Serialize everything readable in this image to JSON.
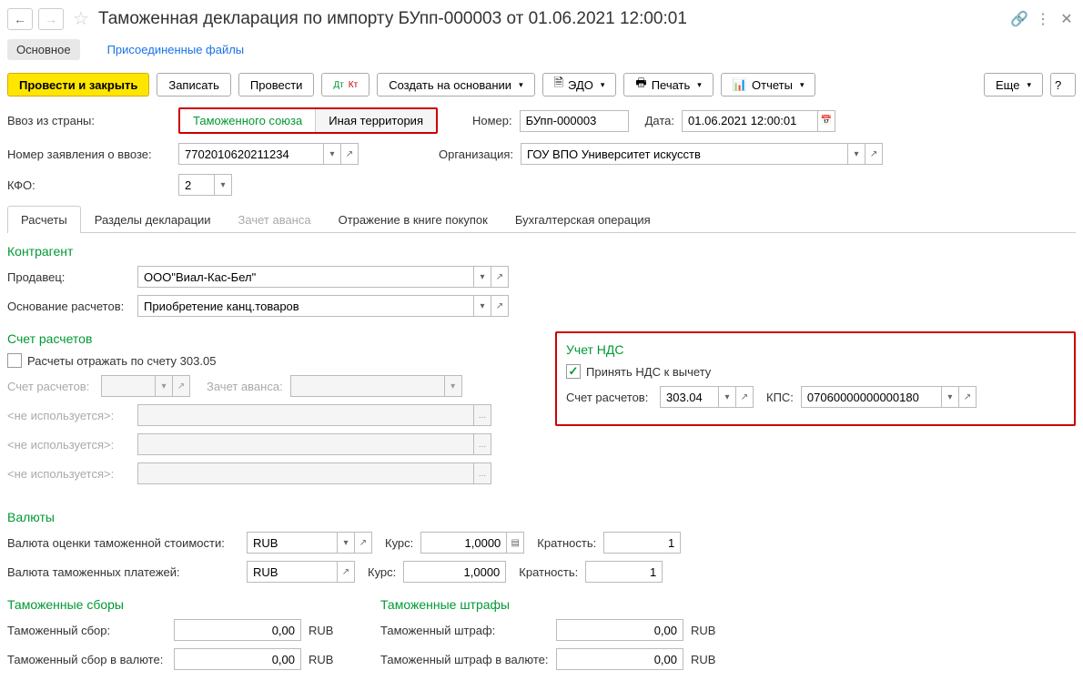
{
  "header": {
    "title": "Таможенная декларация по импорту БУпп-000003 от 01.06.2021 12:00:01"
  },
  "subnav": {
    "main": "Основное",
    "files": "Присоединенные файлы"
  },
  "toolbar": {
    "post_close": "Провести и закрыть",
    "save": "Записать",
    "post": "Провести",
    "create_based": "Создать на основании",
    "edo": "ЭДО",
    "print": "Печать",
    "reports": "Отчеты",
    "more": "Еще",
    "help": "?"
  },
  "form": {
    "import_from_label": "Ввоз из страны:",
    "toggle_union": "Таможенного союза",
    "toggle_other": "Иная территория",
    "number_label": "Номер:",
    "number_value": "БУпп-000003",
    "date_label": "Дата:",
    "date_value": "01.06.2021 12:00:01",
    "app_num_label": "Номер заявления о ввозе:",
    "app_num_value": "7702010620211234",
    "org_label": "Организация:",
    "org_value": "ГОУ ВПО Университет искусств",
    "kfo_label": "КФО:",
    "kfo_value": "2"
  },
  "tabs": {
    "t1": "Расчеты",
    "t2": "Разделы декларации",
    "t3": "Зачет аванса",
    "t4": "Отражение в книге покупок",
    "t5": "Бухгалтерская операция"
  },
  "counterparty": {
    "title": "Контрагент",
    "seller_label": "Продавец:",
    "seller_value": "ООО\"Виал-Кас-Бел\"",
    "basis_label": "Основание расчетов:",
    "basis_value": "Приобретение канц.товаров"
  },
  "settlement": {
    "title": "Счет расчетов",
    "reflect_label": "Расчеты отражать по счету 303.05",
    "account_label": "Счет расчетов:",
    "advance_label": "Зачет аванса:",
    "unused": "<не используется>:",
    "ellipsis": "..."
  },
  "vat": {
    "title": "Учет НДС",
    "accept_label": "Принять НДС к вычету",
    "account_label": "Счет расчетов:",
    "account_value": "303.04",
    "kps_label": "КПС:",
    "kps_value": "07060000000000180"
  },
  "currencies": {
    "title": "Валюты",
    "eval_label": "Валюта оценки таможенной стоимости:",
    "eval_value": "RUB",
    "rate_label": "Курс:",
    "rate_value": "1,0000",
    "mult_label": "Кратность:",
    "mult_value": "1",
    "pay_label": "Валюта таможенных платежей:",
    "pay_value": "RUB",
    "pay_rate": "1,0000",
    "pay_mult": "1"
  },
  "fees": {
    "title": "Таможенные сборы",
    "fee_label": "Таможенный сбор:",
    "fee_value": "0,00",
    "fee_cur_label": "Таможенный сбор в валюте:",
    "fee_cur_value": "0,00",
    "rub": "RUB"
  },
  "fines": {
    "title": "Таможенные штрафы",
    "fine_label": "Таможенный штраф:",
    "fine_value": "0,00",
    "fine_cur_label": "Таможенный штраф в валюте:",
    "fine_cur_value": "0,00",
    "rub": "RUB"
  }
}
